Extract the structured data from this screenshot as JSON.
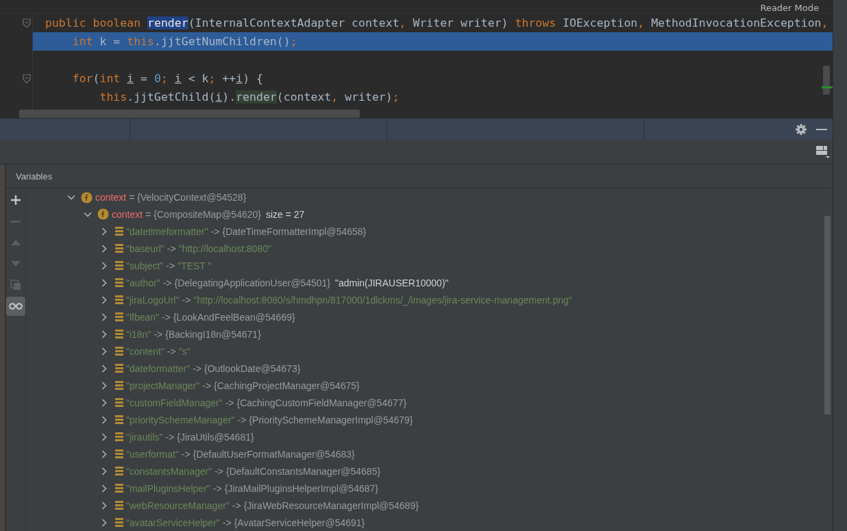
{
  "editor": {
    "reader_mode": "Reader Mode",
    "lines": [
      {
        "current": false,
        "fold": true,
        "tokens": [
          {
            "kind": "kw",
            "text": "public boolean "
          },
          {
            "kind": "hl",
            "text": "render"
          },
          {
            "kind": "plain",
            "text": "(InternalContextAdapter context"
          },
          {
            "kind": "punct",
            "text": ", "
          },
          {
            "kind": "plain",
            "text": "Writer writer) "
          },
          {
            "kind": "kw",
            "text": "throws "
          },
          {
            "kind": "plain",
            "text": "IOException"
          },
          {
            "kind": "punct",
            "text": ", "
          },
          {
            "kind": "plain",
            "text": "MethodInvocationException"
          },
          {
            "kind": "punct",
            "text": ","
          }
        ]
      },
      {
        "current": true,
        "fold": false,
        "tokens": [
          {
            "kind": "kw",
            "text": "    int "
          },
          {
            "kind": "plain",
            "text": "k = "
          },
          {
            "kind": "kw",
            "text": "this"
          },
          {
            "kind": "plain",
            "text": ".jjtGetNumChildren()"
          },
          {
            "kind": "punct",
            "text": ";"
          }
        ]
      },
      {
        "current": false,
        "fold": false
      },
      {
        "current": false,
        "fold": true,
        "tokens": [
          {
            "kind": "kw",
            "text": "    for"
          },
          {
            "kind": "plain",
            "text": "("
          },
          {
            "kind": "kw",
            "text": "int "
          },
          {
            "kind": "var",
            "text": "i"
          },
          {
            "kind": "plain",
            "text": " = "
          },
          {
            "kind": "num",
            "text": "0"
          },
          {
            "kind": "punct",
            "text": "; "
          },
          {
            "kind": "var",
            "text": "i"
          },
          {
            "kind": "plain",
            "text": " < k"
          },
          {
            "kind": "punct",
            "text": "; "
          },
          {
            "kind": "plain",
            "text": "++"
          },
          {
            "kind": "var",
            "text": "i"
          },
          {
            "kind": "plain",
            "text": ") {"
          }
        ]
      },
      {
        "current": false,
        "fold": false,
        "tokens": [
          {
            "kind": "kw",
            "text": "        this"
          },
          {
            "kind": "plain",
            "text": ".jjtGetChild("
          },
          {
            "kind": "var",
            "text": "i"
          },
          {
            "kind": "plain",
            "text": ")."
          },
          {
            "kind": "match",
            "text": "render"
          },
          {
            "kind": "plain",
            "text": "(context"
          },
          {
            "kind": "punct",
            "text": ", "
          },
          {
            "kind": "plain",
            "text": "writer)"
          },
          {
            "kind": "punct",
            "text": ";"
          }
        ]
      }
    ]
  },
  "variables": {
    "title": "Variables",
    "toolbar": [
      {
        "kind": "add",
        "disabled": false,
        "selected": false
      },
      {
        "kind": "remove",
        "disabled": true,
        "selected": false
      },
      {
        "kind": "up",
        "disabled": true,
        "selected": false
      },
      {
        "kind": "down",
        "disabled": true,
        "selected": false
      },
      {
        "kind": "copy",
        "disabled": true,
        "selected": false
      },
      {
        "kind": "watch",
        "disabled": false,
        "selected": true
      }
    ],
    "tree": [
      {
        "kind": "field",
        "expanded": true,
        "name": "context",
        "separator": "=",
        "value": "{VelocityContext@54528}",
        "children": [
          {
            "kind": "field",
            "expanded": true,
            "name": "context",
            "separator": "=",
            "value": "{CompositeMap@54620}",
            "extra": "size = 27",
            "children": [
              {
                "kind": "entry",
                "expanded": false,
                "name": "\"datetimeformatter\"",
                "separator": "->",
                "value": "{DateTimeFormatterImpl@54658}",
                "string_value": false
              },
              {
                "kind": "entry",
                "expanded": false,
                "name": "\"baseurl\"",
                "separator": "->",
                "value": "\"http://localhost:8080\"",
                "string_value": true
              },
              {
                "kind": "entry",
                "expanded": false,
                "name": "\"subject\"",
                "separator": "->",
                "value": "\"TEST \"",
                "string_value": true
              },
              {
                "kind": "entry",
                "expanded": false,
                "name": "\"author\"",
                "separator": "->",
                "value": "{DelegatingApplicationUser@54501}",
                "string_value": false,
                "extra": "\"admin(JIRAUSER10000)\""
              },
              {
                "kind": "entry",
                "expanded": false,
                "name": "\"jiraLogoUrl\"",
                "separator": "->",
                "value": "\"http://localhost:8080/s/hmdhpn/817000/1dlckms/_/images/jira-service-management.png\"",
                "string_value": true
              },
              {
                "kind": "entry",
                "expanded": false,
                "name": "\"lfbean\"",
                "separator": "->",
                "value": "{LookAndFeelBean@54669}",
                "string_value": false
              },
              {
                "kind": "entry",
                "expanded": false,
                "name": "\"i18n\"",
                "separator": "->",
                "value": "{BackingI18n@54671}",
                "string_value": false
              },
              {
                "kind": "entry",
                "expanded": false,
                "name": "\"content\"",
                "separator": "->",
                "value": "\"s\"",
                "string_value": true
              },
              {
                "kind": "entry",
                "expanded": false,
                "name": "\"dateformatter\"",
                "separator": "->",
                "value": "{OutlookDate@54673}",
                "string_value": false
              },
              {
                "kind": "entry",
                "expanded": false,
                "name": "\"projectManager\"",
                "separator": "->",
                "value": "{CachingProjectManager@54675}",
                "string_value": false
              },
              {
                "kind": "entry",
                "expanded": false,
                "name": "\"customFieldManager\"",
                "separator": "->",
                "value": "{CachingCustomFieldManager@54677}",
                "string_value": false
              },
              {
                "kind": "entry",
                "expanded": false,
                "name": "\"prioritySchemeManager\"",
                "separator": "->",
                "value": "{PrioritySchemeManagerImpl@54679}",
                "string_value": false
              },
              {
                "kind": "entry",
                "expanded": false,
                "name": "\"jirautils\"",
                "separator": "->",
                "value": "{JiraUtils@54681}",
                "string_value": false
              },
              {
                "kind": "entry",
                "expanded": false,
                "name": "\"userformat\"",
                "separator": "->",
                "value": "{DefaultUserFormatManager@54683}",
                "string_value": false
              },
              {
                "kind": "entry",
                "expanded": false,
                "name": "\"constantsManager\"",
                "separator": "->",
                "value": "{DefaultConstantsManager@54685}",
                "string_value": false
              },
              {
                "kind": "entry",
                "expanded": false,
                "name": "\"mailPluginsHelper\"",
                "separator": "->",
                "value": "{JiraMailPluginsHelperImpl@54687}",
                "string_value": false
              },
              {
                "kind": "entry",
                "expanded": false,
                "name": "\"webResourceManager\"",
                "separator": "->",
                "value": "{JiraWebResourceManagerImpl@54689}",
                "string_value": false
              },
              {
                "kind": "entry",
                "expanded": false,
                "name": "\"avatarServiceHelper\"",
                "separator": "->",
                "value": "{AvatarServiceHelper@54691}",
                "string_value": false
              }
            ]
          }
        ]
      }
    ]
  }
}
